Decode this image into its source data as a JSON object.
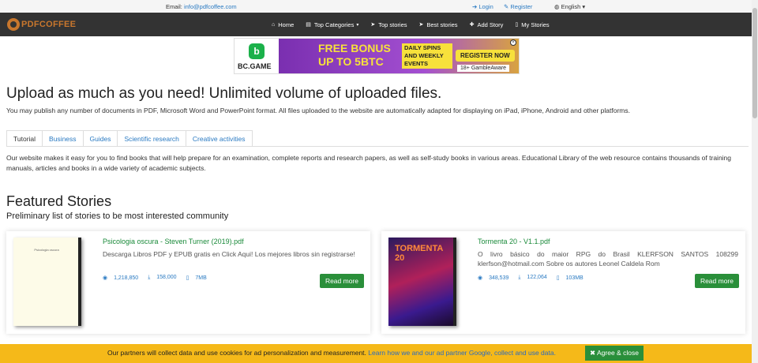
{
  "topbar": {
    "email_label": "Email:",
    "email_value": "info@pdfcoffee.com",
    "login": "Login",
    "register": "Register",
    "language": "English"
  },
  "logo": {
    "text": "PDFCOFFEE"
  },
  "nav": {
    "items": [
      {
        "label": "Home",
        "icon": "home-icon"
      },
      {
        "label": "Top Categories",
        "icon": "list-icon"
      },
      {
        "label": "Top stories",
        "icon": "paper-plane-icon"
      },
      {
        "label": "Best stories",
        "icon": "paper-plane-icon"
      },
      {
        "label": "Add Story",
        "icon": "plus-icon"
      },
      {
        "label": "My Stories",
        "icon": "file-icon"
      }
    ]
  },
  "banner": {
    "brand": "BC.GAME",
    "headline": "FREE BONUS UP TO 5BTC",
    "subline": "DAILY SPINS AND WEEKLY EVENTS",
    "cta": "REGISTER NOW",
    "age": "18+ GambleAware"
  },
  "upload": {
    "title": "Upload as much as you need! Unlimited volume of uploaded files.",
    "subtitle": "You may publish any number of documents in PDF, Microsoft Word and PowerPoint format. All files uploaded to the website are automatically adapted for displaying on iPad, iPhone, Android and other platforms."
  },
  "tabs": [
    "Tutorial",
    "Business",
    "Guides",
    "Scientific research",
    "Creative activities"
  ],
  "tab_content": "Our website makes it easy for you to find books that will help prepare for an examination, complete reports and research papers, as well as self-study books in various areas. Educational Library of the web resource contains thousands of training manuals, articles and books in a wide variety of academic subjects.",
  "featured": {
    "title": "Featured Stories",
    "subtitle": "Preliminary list of stories to be most interested community"
  },
  "cards": [
    {
      "title": "Psicologia oscura - Steven Turner (2019).pdf",
      "description": "Descarga Libros PDF y EPUB gratis en Click Aqui! Los mejores libros sin registrarse!",
      "views": "1,218,850",
      "downloads": "158,000",
      "size": "7MB",
      "button": "Read more",
      "cover_text": "Psicologia oscura"
    },
    {
      "title": "Tormenta 20 - V1.1.pdf",
      "description": "O livro básico do maior RPG do Brasil KLERFSON SANTOS 108299 klerfson@hotmail.com Sobre os autores Leonel Caldela Rom",
      "views": "348,539",
      "downloads": "122,064",
      "size": "103MB",
      "button": "Read more",
      "cover_text": "TORMENTA 20"
    }
  ],
  "cookie": {
    "text": "Our partners will collect data and use cookies for ad personalization and measurement.",
    "link": "Learn how we and our ad partner Google, collect and use data.",
    "button": "Agree & close"
  },
  "colors": {
    "navbar": "#333333",
    "logo": "#c9772d",
    "link": "#2a7ac2",
    "green": "#2a8f3a",
    "cookie": "#f5b919"
  }
}
